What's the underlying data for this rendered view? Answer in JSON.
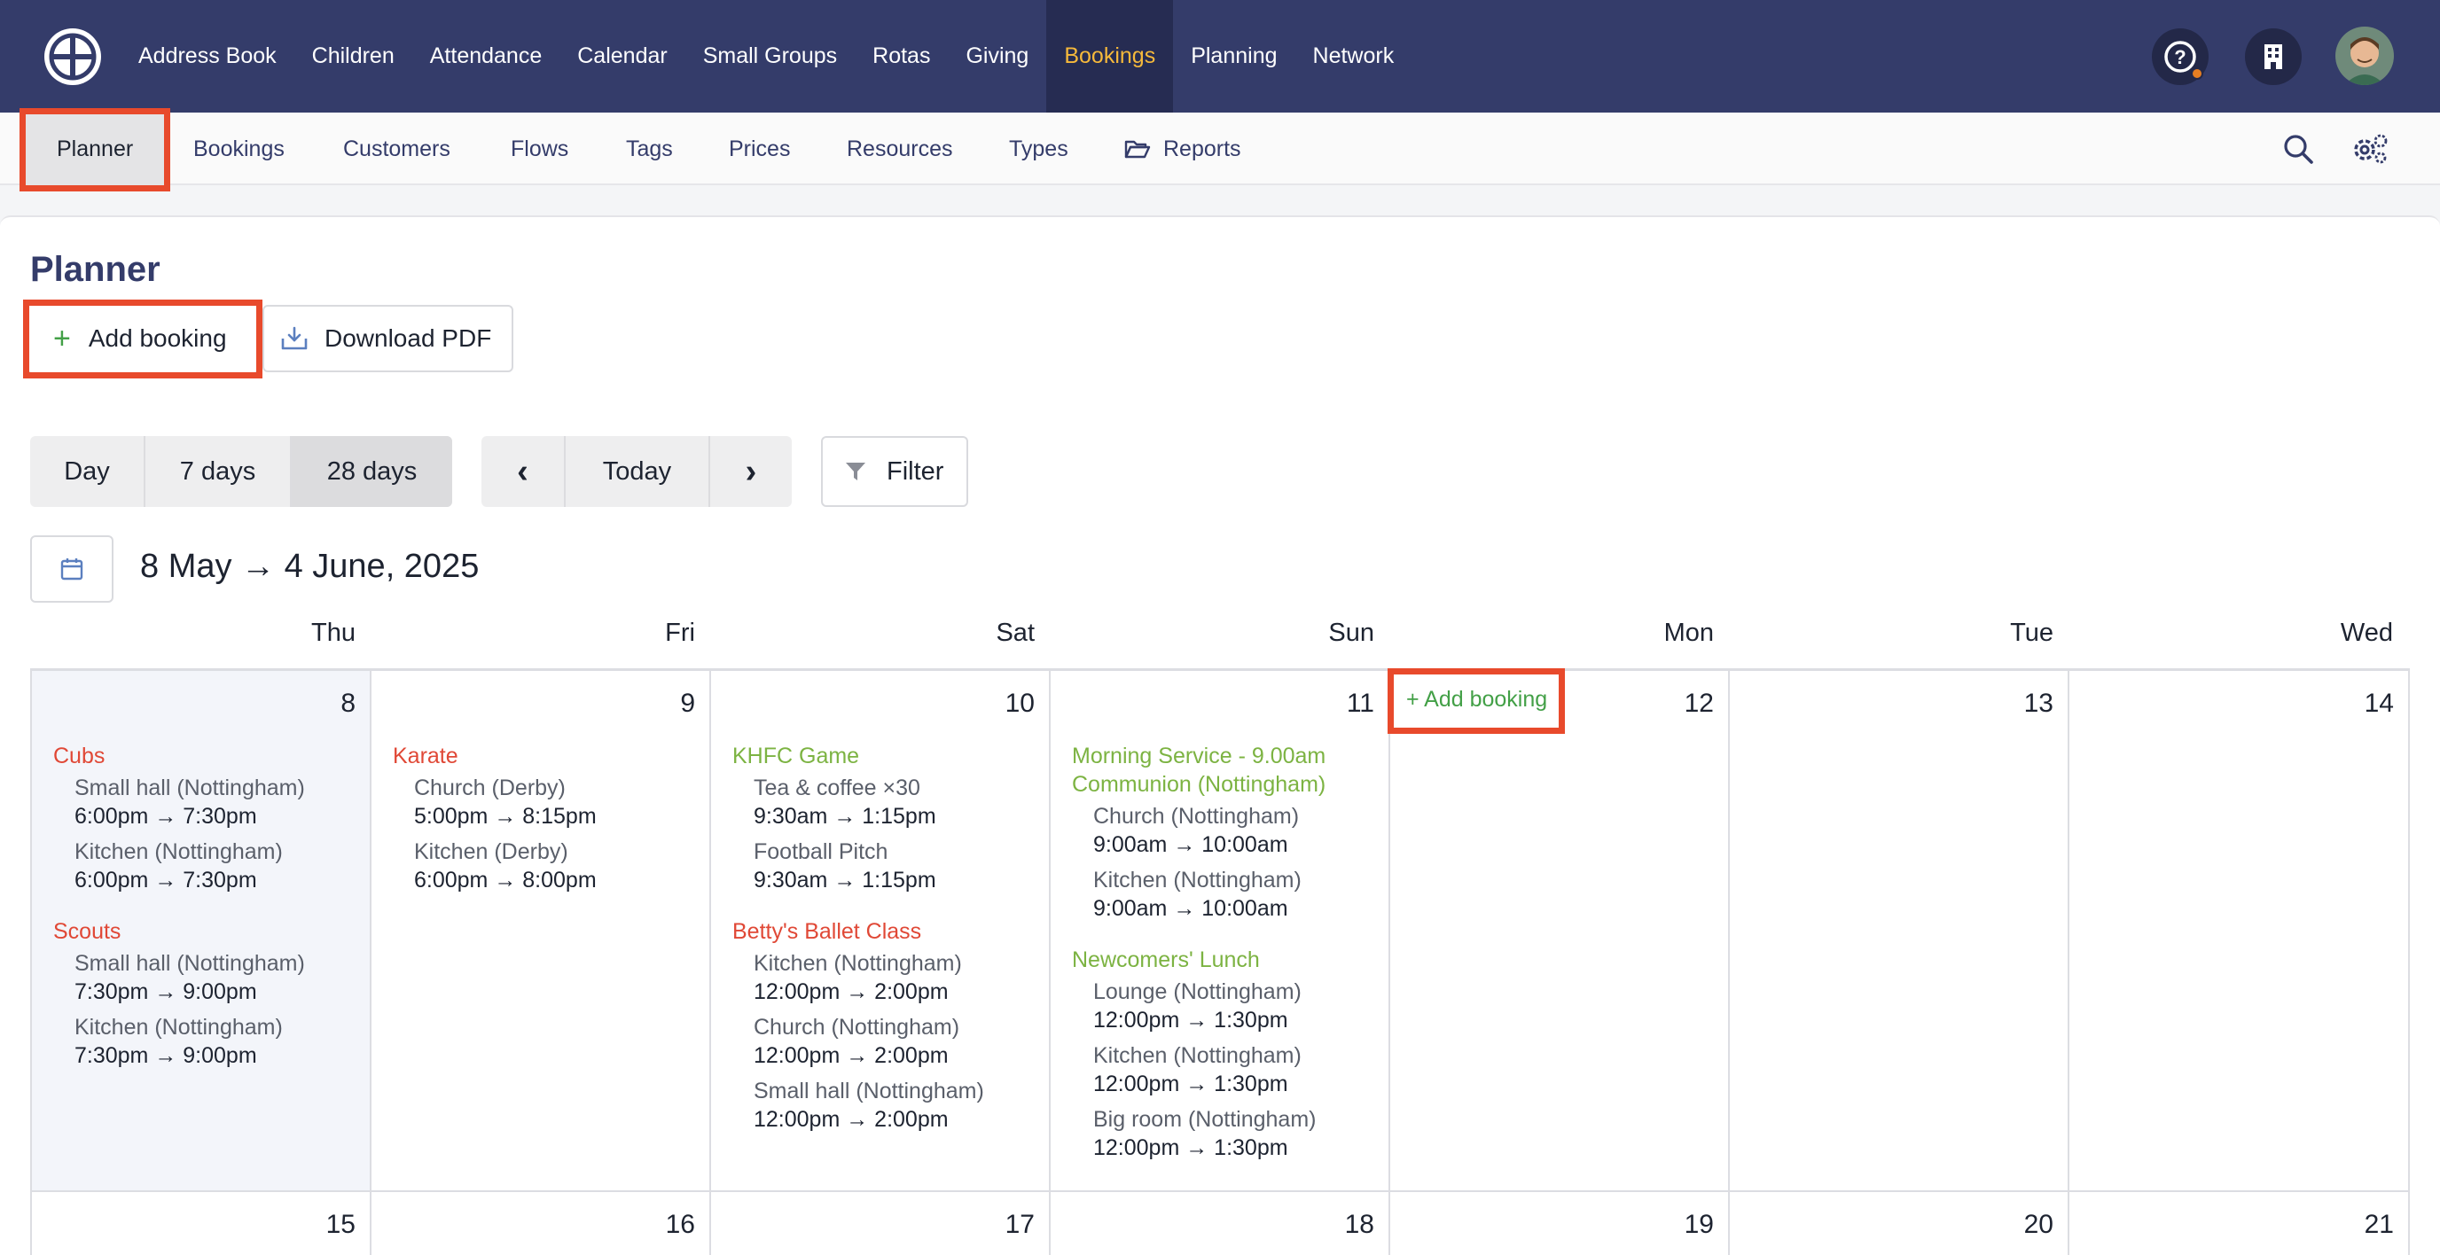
{
  "top_nav": {
    "items": [
      "Address Book",
      "Children",
      "Attendance",
      "Calendar",
      "Small Groups",
      "Rotas",
      "Giving",
      "Bookings",
      "Planning",
      "Network"
    ],
    "active": "Bookings",
    "logo_icon": "wheel-logo-icon",
    "right_icons": [
      "help-icon",
      "building-icon",
      "avatar"
    ],
    "colors": {
      "bg": "#343c6a",
      "active_bg": "#262c52",
      "active_text": "#f6b93b",
      "notification_dot": "#e67e22"
    }
  },
  "sub_nav": {
    "items": [
      "Planner",
      "Bookings",
      "Customers",
      "Flows",
      "Tags",
      "Prices",
      "Resources",
      "Types",
      "Reports"
    ],
    "active": "Planner",
    "right_icons": [
      "search-icon",
      "settings-icon"
    ]
  },
  "page": {
    "title": "Planner",
    "add_booking": "Add booking",
    "download_pdf": "Download PDF"
  },
  "view_toggle": {
    "options": [
      "Day",
      "7 days",
      "28 days"
    ],
    "active": "28 days"
  },
  "nav_controls": {
    "prev": "‹",
    "today": "Today",
    "next": "›"
  },
  "filter_label": "Filter",
  "date_range": "8 May → 4 June, 2025",
  "calendar": {
    "weekdays": [
      "Thu",
      "Fri",
      "Sat",
      "Sun",
      "Mon",
      "Tue",
      "Wed"
    ],
    "week1_days": [
      "8",
      "9",
      "10",
      "11",
      "12",
      "13",
      "14"
    ],
    "week2_days": [
      "15",
      "16",
      "17",
      "18",
      "19",
      "20",
      "21"
    ],
    "inline_add": "+ Add booking",
    "events": {
      "thu": [
        {
          "title": "Cubs",
          "color": "red",
          "resources": [
            {
              "loc": "Small hall (Nottingham)",
              "time": "6:00pm → 7:30pm"
            },
            {
              "loc": "Kitchen (Nottingham)",
              "time": "6:00pm → 7:30pm"
            }
          ]
        },
        {
          "title": "Scouts",
          "color": "red",
          "resources": [
            {
              "loc": "Small hall (Nottingham)",
              "time": "7:30pm → 9:00pm"
            },
            {
              "loc": "Kitchen (Nottingham)",
              "time": "7:30pm → 9:00pm"
            }
          ]
        }
      ],
      "fri": [
        {
          "title": "Karate",
          "color": "red",
          "resources": [
            {
              "loc": "Church (Derby)",
              "time": "5:00pm → 8:15pm"
            },
            {
              "loc": "Kitchen (Derby)",
              "time": "6:00pm → 8:00pm"
            }
          ]
        }
      ],
      "sat": [
        {
          "title": "KHFC Game",
          "color": "green",
          "resources": [
            {
              "loc": "Tea & coffee ×30",
              "time": "9:30am → 1:15pm"
            },
            {
              "loc": "Football Pitch",
              "time": "9:30am → 1:15pm"
            }
          ]
        },
        {
          "title": "Betty's Ballet Class",
          "color": "red",
          "resources": [
            {
              "loc": "Kitchen (Nottingham)",
              "time": "12:00pm → 2:00pm"
            },
            {
              "loc": "Church (Nottingham)",
              "time": "12:00pm → 2:00pm"
            },
            {
              "loc": "Small hall (Nottingham)",
              "time": "12:00pm → 2:00pm"
            }
          ]
        }
      ],
      "sun": [
        {
          "title": "Morning Service - 9.00am Communion (Nottingham)",
          "color": "green",
          "resources": [
            {
              "loc": "Church (Nottingham)",
              "time": "9:00am → 10:00am"
            },
            {
              "loc": "Kitchen (Nottingham)",
              "time": "9:00am → 10:00am"
            }
          ]
        },
        {
          "title": "Newcomers' Lunch",
          "color": "green",
          "resources": [
            {
              "loc": "Lounge (Nottingham)",
              "time": "12:00pm → 1:30pm"
            },
            {
              "loc": "Kitchen (Nottingham)",
              "time": "12:00pm → 1:30pm"
            },
            {
              "loc": "Big room (Nottingham)",
              "time": "12:00pm → 1:30pm"
            }
          ]
        }
      ]
    }
  },
  "highlight_color": "#e84a2c"
}
